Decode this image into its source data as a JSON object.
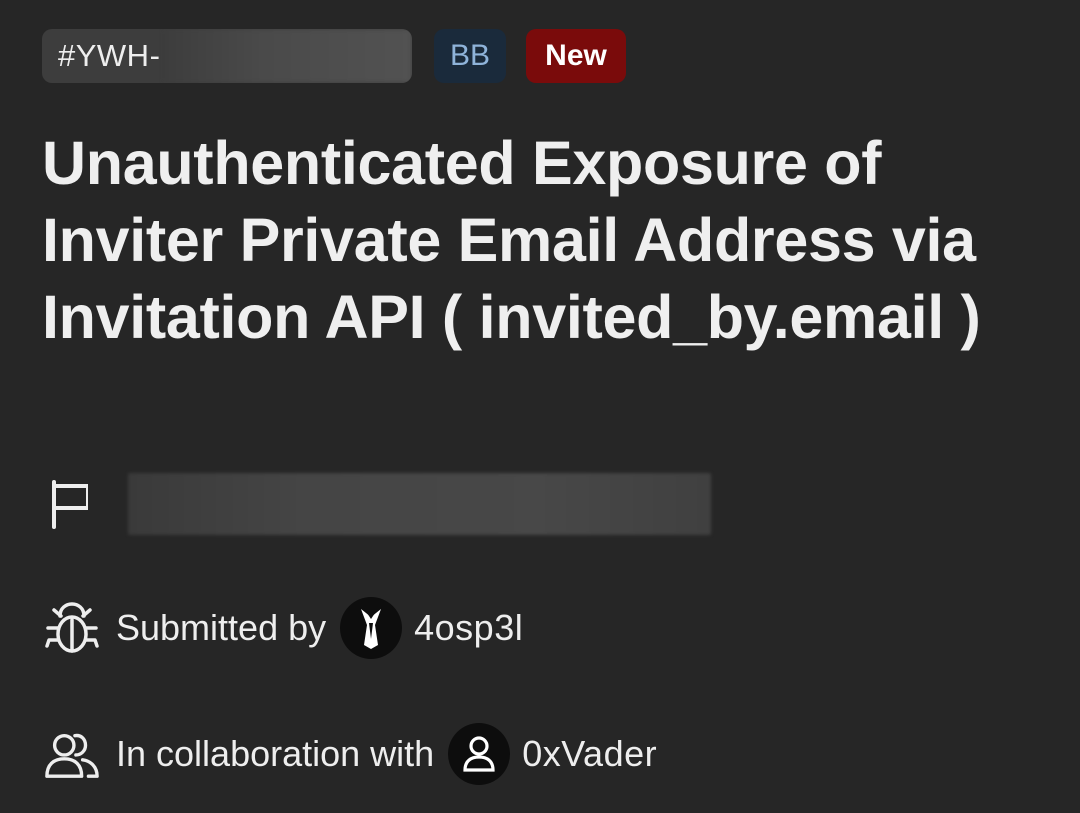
{
  "header": {
    "report_id_prefix": "#YWH-",
    "program_badge": "BB",
    "status_badge": "New"
  },
  "report": {
    "title": "Unauthenticated Exposure of Inviter Private Email Address via Invitation API ( invited_by.email )"
  },
  "scope": {
    "icon": "flag-icon"
  },
  "submitted": {
    "icon": "bug-icon",
    "label": "Submitted by",
    "avatar_icon": "tuxedo-avatar-icon",
    "username": "4osp3l"
  },
  "collaboration": {
    "icon": "users-icon",
    "label": "In collaboration with",
    "avatar_icon": "user-icon",
    "username": "0xVader"
  },
  "colors": {
    "background": "#262626",
    "status_new": "#7a0b0b",
    "program_badge_bg": "#1a2a3b",
    "program_badge_text": "#8fb3d9"
  }
}
